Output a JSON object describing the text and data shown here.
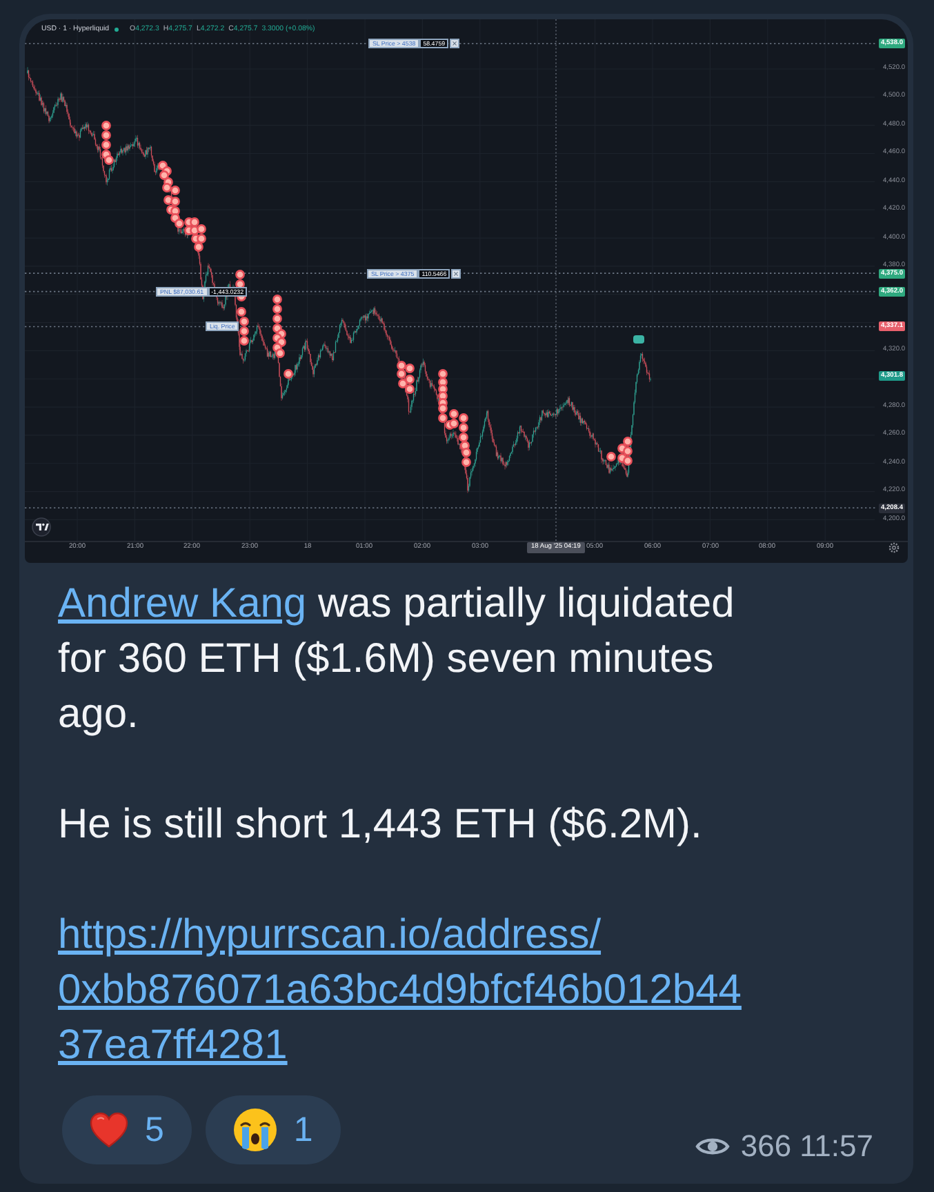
{
  "chart": {
    "symbol": "USD · 1 · Hyperliquid",
    "ohlc": [
      {
        "key": "O",
        "value": "4,272.3"
      },
      {
        "key": "H",
        "value": "4,275.7"
      },
      {
        "key": "L",
        "value": "4,272.2"
      },
      {
        "key": "C",
        "value": "4,275.7"
      }
    ],
    "change": "3.3000 (+0.08%)",
    "price_lines": [
      {
        "price": "4,538.0",
        "color": "#2fa97f",
        "kind": "line",
        "order": {
          "label": "SL Price > 4538",
          "quantity": "58.4759",
          "closable": true
        }
      },
      {
        "price": "4,375.0",
        "color": "#2fa97f",
        "kind": "line",
        "order": {
          "label": "SL Price > 4375",
          "quantity": "110.5466",
          "closable": true
        }
      },
      {
        "price": "4,362.0",
        "color": "#2fa97f",
        "kind": "line",
        "order": {
          "label": "PNL $87,030.61",
          "quantity": "-1,443.0232",
          "closable": false
        }
      },
      {
        "price": "4,337.1",
        "color": "#e8606c",
        "kind": "line",
        "order": {
          "label": "Liq. Price",
          "closable": false
        }
      },
      {
        "price": "4,301.8",
        "color": "#1f9b8a",
        "kind": "last"
      },
      {
        "price": "4,208.4",
        "color": "#2a2e39",
        "kind": "line"
      }
    ],
    "y_ticks": [
      "4,520.0",
      "4,500.0",
      "4,480.0",
      "4,460.0",
      "4,440.0",
      "4,420.0",
      "4,400.0",
      "4,380.0",
      "4,320.0",
      "4,280.0",
      "4,260.0",
      "4,240.0",
      "4,220.0",
      "4,200.0"
    ],
    "x_ticks": [
      "20:00",
      "21:00",
      "22:00",
      "23:00",
      "18",
      "01:00",
      "02:00",
      "03:00",
      "05:00",
      "06:00",
      "07:00",
      "08:00",
      "09:00"
    ],
    "crosshair_label": "18 Aug '25 04:19"
  },
  "message": {
    "paragraphs": [
      {
        "kind": "mention",
        "link": "Andrew Kang",
        "text": "was partially liquidated for 360 ETH ($1.6M) seven minutes ago."
      },
      {
        "kind": "plain",
        "text": "He is still short 1,443 ETH ($6.2M)."
      },
      {
        "kind": "url",
        "link": "https://hypurrscan.io/address/0xbb876071a63bc4d9bfcf46b012b4437ea7ff4281"
      }
    ]
  },
  "reactions": [
    {
      "kind": "heart",
      "count": "5",
      "selected": false
    },
    {
      "kind": "crying",
      "count": "1",
      "selected": false
    }
  ],
  "views": "366",
  "time": "11:57"
}
